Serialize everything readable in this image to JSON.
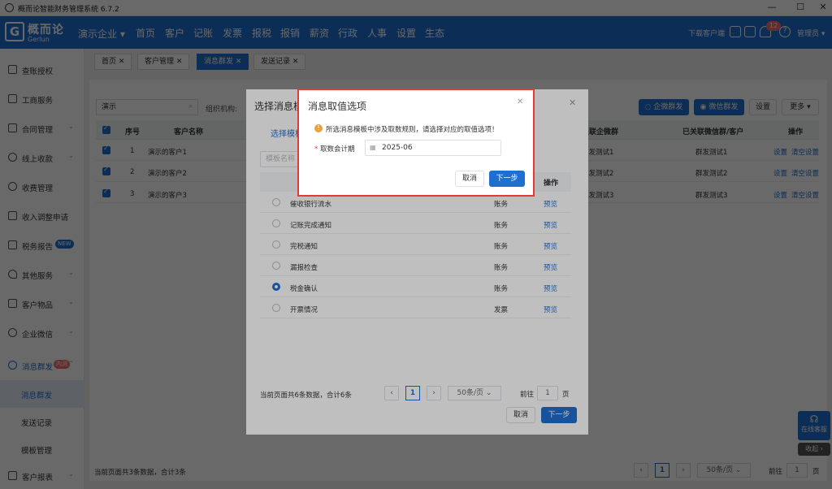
{
  "window": {
    "title": "概而论智能财务管理系统 6.7.2",
    "controls": [
      "—",
      "☐",
      "✕"
    ]
  },
  "nav": {
    "logo_cn": "概而论",
    "logo_en": "Gerlun",
    "logo_mark": "G",
    "company": "演示企业",
    "items": [
      "首页",
      "客户",
      "记账",
      "发票",
      "报税",
      "报销",
      "薪资",
      "行政",
      "人事",
      "设置",
      "生态"
    ],
    "download": "下载客户端",
    "notif_count": "12",
    "user": "管理员"
  },
  "sidebar": {
    "items": [
      {
        "label": "查账授权"
      },
      {
        "label": "工商服务"
      },
      {
        "label": "合同管理"
      },
      {
        "label": "线上收款"
      },
      {
        "label": "收费管理"
      },
      {
        "label": "收入调整申请"
      },
      {
        "label": "税务报告",
        "badge": "NEW"
      },
      {
        "label": "其他服务"
      },
      {
        "label": "客户物品"
      },
      {
        "label": "企业微信"
      },
      {
        "label": "消息群发",
        "badge": "内测"
      }
    ],
    "sub": [
      "消息群发",
      "发送记录",
      "模板管理"
    ],
    "last": "客户报表"
  },
  "tabs": [
    "首页",
    "客户管理",
    "消息群发",
    "发送记录"
  ],
  "main": {
    "search_value": "演示",
    "org_label": "组织机构:",
    "btn_qywx": "企微群发",
    "btn_wx": "微信群发",
    "btn_settings": "设置",
    "btn_more": "更多",
    "headers": [
      "序号",
      "客户名称",
      "关联企微群",
      "已关联微信群/客户",
      "操作"
    ],
    "rows": [
      {
        "no": "1",
        "name": "演示的客户1",
        "qw": "群发测试1",
        "wx": "群发测试1"
      },
      {
        "no": "2",
        "name": "演示的客户2",
        "qw": "群发测试2",
        "wx": "群发测试2"
      },
      {
        "no": "3",
        "name": "演示的客户3",
        "qw": "群发测试3",
        "wx": "群发测试3"
      }
    ],
    "op_set": "设置",
    "op_clear": "清空设置",
    "footer": "当前页面共3条数据，合计3条",
    "page": "1",
    "page_size": "50条/页",
    "goto": "前往",
    "goto_page": "1",
    "page_unit": "页"
  },
  "dialog1": {
    "title": "选择消息模",
    "tab": "选择模板",
    "search_placeholder": "模板名称",
    "col_op": "操作",
    "rows": [
      {
        "name": "催收银行流水",
        "cat": "账务",
        "op": "预览",
        "selected": false
      },
      {
        "name": "记账完成通知",
        "cat": "账务",
        "op": "预览",
        "selected": false
      },
      {
        "name": "完税通知",
        "cat": "账务",
        "op": "预览",
        "selected": false
      },
      {
        "name": "漏报检查",
        "cat": "账务",
        "op": "预览",
        "selected": false
      },
      {
        "name": "税金确认",
        "cat": "账务",
        "op": "预览",
        "selected": true
      },
      {
        "name": "开票情况",
        "cat": "发票",
        "op": "预览",
        "selected": false
      }
    ],
    "footer": "当前页面共6条数据，合计6条",
    "page": "1",
    "page_size": "50条/页",
    "goto": "前往",
    "goto_page": "1",
    "page_unit": "页",
    "cancel": "取消",
    "next": "下一步"
  },
  "dialog2": {
    "title": "消息取值选项",
    "notice": "所选消息模板中涉及取数规则，请选择对应的取值选项！",
    "field_label": "取数会计期",
    "field_value": "2025-06",
    "cancel": "取消",
    "next": "下一步"
  },
  "float": {
    "service": "在线客服",
    "collapse": "收起"
  },
  "colors": {
    "primary": "#1f6fd1",
    "danger": "#e53935"
  }
}
